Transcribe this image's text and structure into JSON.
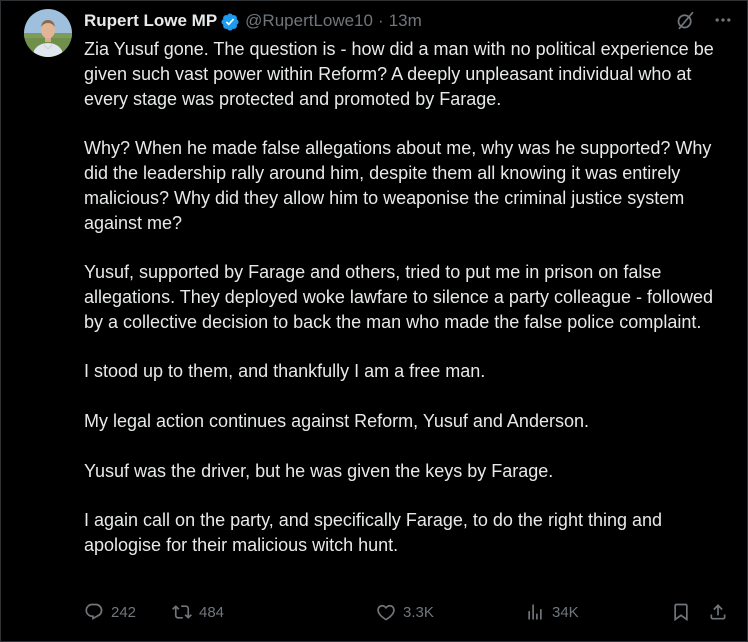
{
  "author": {
    "display_name": "Rupert Lowe MP",
    "handle": "@RupertLowe10",
    "separator": "·",
    "timestamp": "13m",
    "verified": true,
    "verified_color": "#1d9bf0"
  },
  "header_actions": {
    "grok_icon": "grok-icon",
    "more_icon": "more-icon"
  },
  "tweet": {
    "paragraphs": [
      "Zia Yusuf gone. The question is - how did a man with no political experience be given such vast power within Reform? A deeply unpleasant individual who at every stage was protected and promoted by Farage.",
      "Why? When he made false allegations about me, why was he supported? Why did the leadership rally around him, despite them all knowing it was entirely malicious? Why did they allow him to weaponise the criminal justice system against me?",
      "Yusuf, supported by Farage and others, tried to put me in prison on false allegations. They deployed woke lawfare to silence a party colleague - followed by a collective decision to back the man who made the false police complaint.",
      "I stood up to them, and thankfully I am a free man.",
      "My legal action continues against Reform, Yusuf and Anderson.",
      "Yusuf was the driver, but he was given the keys by Farage.",
      "I again call on the party, and specifically Farage, to do the right thing and apologise for their malicious witch hunt."
    ]
  },
  "actions": {
    "replies": "242",
    "reposts": "484",
    "likes": "3.3K",
    "views": "34K"
  },
  "colors": {
    "background": "#000000",
    "text": "#e7e9ea",
    "muted": "#71767b",
    "border": "#2f3336"
  }
}
